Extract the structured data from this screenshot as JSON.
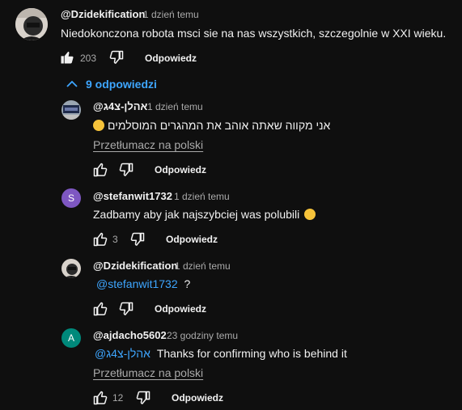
{
  "comment": {
    "handle": "@Dzidekification",
    "time": "1 dzień temu",
    "text": "Niedokonczona robota msci sie na nas wszystkich, szczegolnie w XXI wieku.",
    "likes": "203",
    "reply_label": "Odpowiedz"
  },
  "replies_toggle": {
    "label": "9 odpowiedzi",
    "icon": "chevron-up-icon"
  },
  "replies": [
    {
      "handle": "@אהלן-צ4ג",
      "time": "1 dzień temu",
      "text": "אני מקווה שאתה אוהב את המהגרים המוסלמים",
      "translate": "Przetłumacz na polski",
      "likes": "",
      "reply_label": "Odpowiedz"
    },
    {
      "handle": "@stefanwit1732",
      "time": "1 dzień temu",
      "avatar_letter": "S",
      "avatar_color": "#7e57c2",
      "text": "Zadbamy aby jak najszybciej was polubili",
      "likes": "3",
      "reply_label": "Odpowiedz"
    },
    {
      "handle": "@Dzidekification",
      "time": "1 dzień temu",
      "mention": "@stefanwit1732",
      "text": "?",
      "likes": "",
      "reply_label": "Odpowiedz"
    },
    {
      "handle": "@ajdacho5602",
      "time": "23 godziny temu",
      "avatar_letter": "A",
      "avatar_color": "#00897b",
      "mention": "@אהלן-צ4ג",
      "text": "Thanks for confirming who is behind it",
      "translate": "Przetłumacz na polski",
      "likes": "12",
      "reply_label": "Odpowiedz"
    }
  ],
  "colors": {
    "background": "#0f0f0f",
    "link": "#3ea6ff",
    "muted": "#aaaaaa"
  }
}
